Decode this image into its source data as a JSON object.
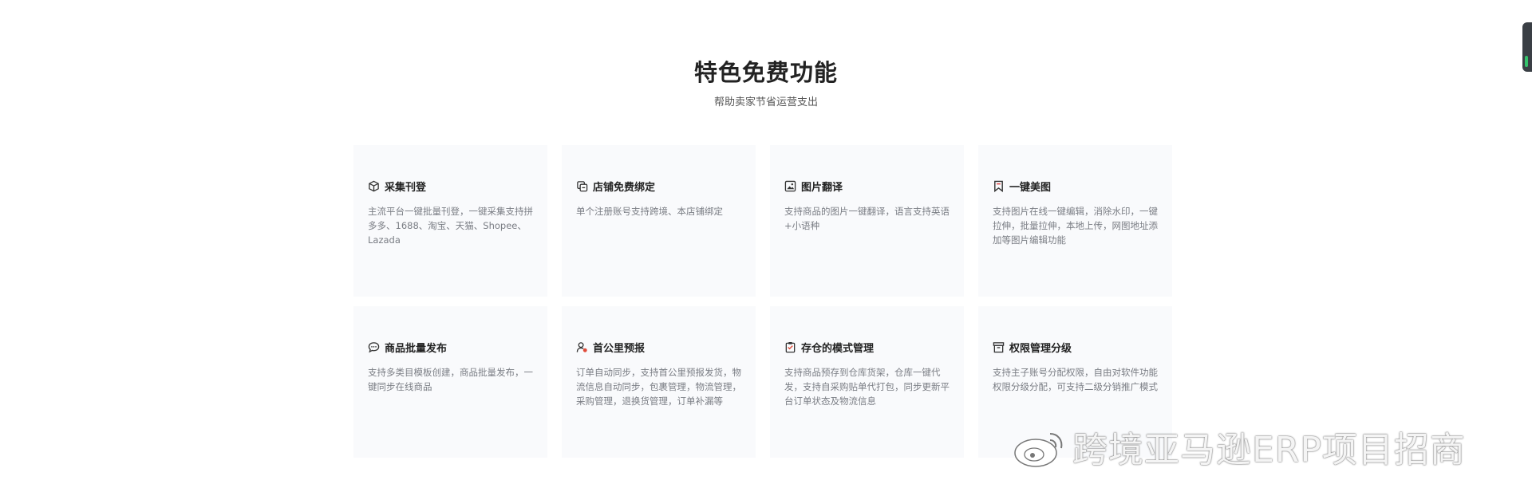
{
  "section": {
    "title": "特色免费功能",
    "subtitle": "帮助卖家节省运营支出"
  },
  "cards": [
    {
      "icon": "package-icon",
      "title": "采集刊登",
      "desc": "主流平台一键批量刊登，一键采集支持拼多多、1688、淘宝、天猫、Shopee、Lazada"
    },
    {
      "icon": "store-link-icon",
      "title": "店铺免费绑定",
      "desc": "单个注册账号支持跨境、本店铺绑定"
    },
    {
      "icon": "image-icon",
      "title": "图片翻译",
      "desc": "支持商品的图片一键翻译，语言支持英语+小语种"
    },
    {
      "icon": "bookmark-icon",
      "title": "一键美图",
      "desc": "支持图片在线一键编辑，消除水印，一键拉伸，批量拉伸，本地上传，网图地址添加等图片编辑功能"
    },
    {
      "icon": "chat-bubble-icon",
      "title": "商品批量发布",
      "desc": "支持多类目模板创建，商品批量发布，一键同步在线商品"
    },
    {
      "icon": "user-location-icon",
      "title": "首公里预报",
      "desc": "订单自动同步，支持首公里预报发货，物流信息自动同步，包裹管理，物流管理，采购管理，退换货管理，订单补漏等"
    },
    {
      "icon": "clipboard-icon",
      "title": "存仓的模式管理",
      "desc": "支持商品预存到仓库货架，仓库一键代发，支持自采购贴单代打包，同步更新平台订单状态及物流信息"
    },
    {
      "icon": "archive-icon",
      "title": "权限管理分级",
      "desc": "支持主子账号分配权限，自由对软件功能权限分级分配，可支持二级分销推广模式"
    }
  ],
  "watermark": {
    "text": "跨境亚马逊ERP项目招商",
    "icon": "weibo-logo-icon"
  }
}
